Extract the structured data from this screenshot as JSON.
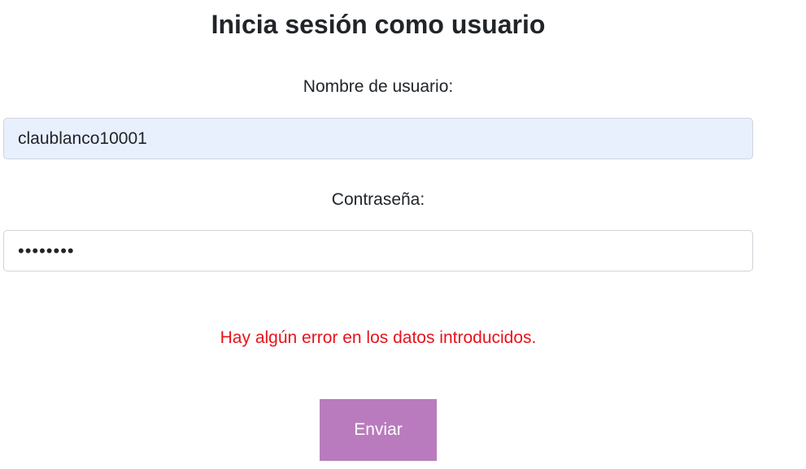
{
  "page": {
    "title": "Inicia sesión como usuario"
  },
  "form": {
    "username_label": "Nombre de usuario:",
    "username_value": "claublanco10001",
    "password_label": "Contraseña:",
    "password_value": "••••••••",
    "error_message": "Hay algún error en los datos introducidos.",
    "submit_label": "Enviar"
  },
  "colors": {
    "accent_button": "#b97bbd",
    "error_text": "#e8121b",
    "autofill_background": "#e8f0fe"
  }
}
